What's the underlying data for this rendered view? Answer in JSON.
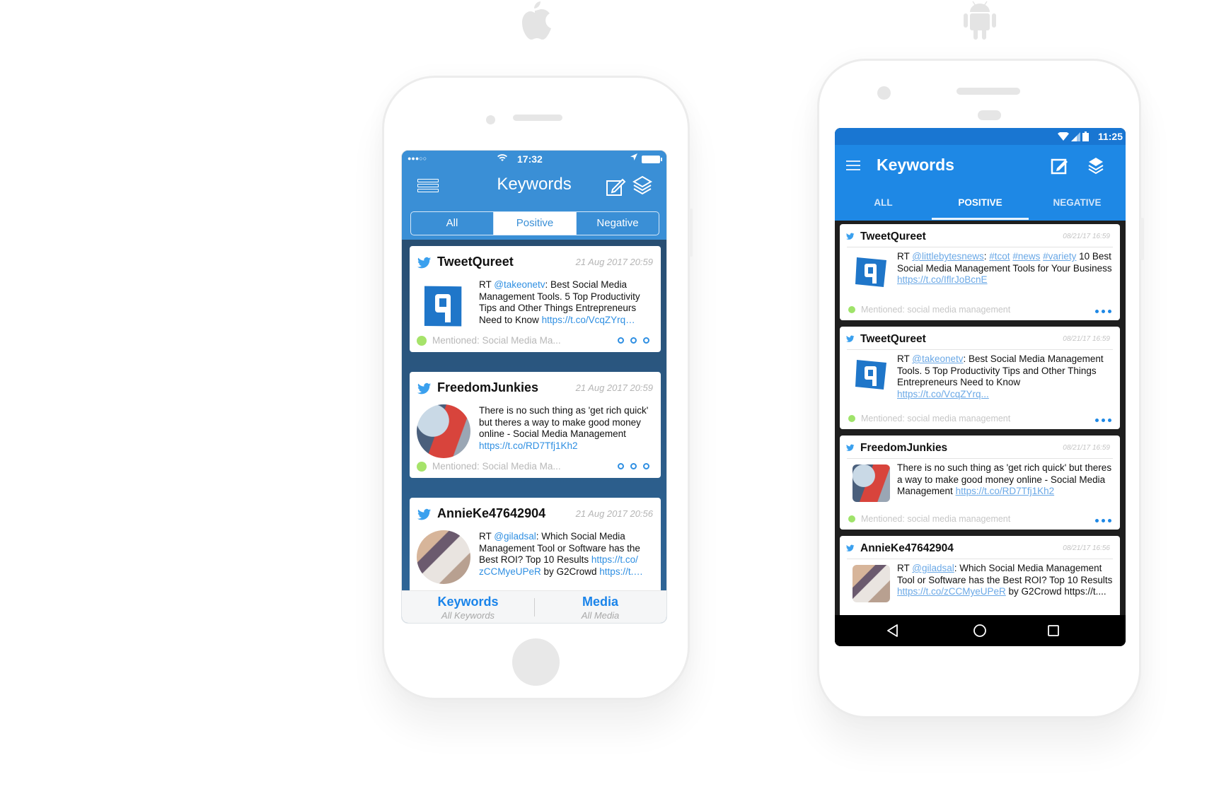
{
  "platform_logos": [
    "apple-logo",
    "android-logo"
  ],
  "ios": {
    "status_bar": {
      "signal": "●●●○○",
      "time": "17:32",
      "wifi_icon": "wifi-icon",
      "location_icon": "location-arrow-icon",
      "battery_icon": "battery-icon"
    },
    "nav": {
      "title": "Keywords",
      "menu_icon": "menu-icon",
      "compose_icon": "compose-icon",
      "layers_icon": "layers-icon"
    },
    "segments": [
      {
        "label": "All",
        "active": false
      },
      {
        "label": "Positive",
        "active": true
      },
      {
        "label": "Negative",
        "active": false
      }
    ],
    "tweets": [
      {
        "author": "TweetQureet",
        "date": "21 Aug 2017 20:59",
        "text_parts": [
          {
            "t": "RT ",
            "link": false
          },
          {
            "t": "@takeonetv",
            "link": true
          },
          {
            "t": ": Best Social Media Management Tools. 5 Top Productivity Tips and Other Things Entrepreneurs Need to Know ",
            "link": false
          },
          {
            "t": "https://t.co/VcqZYrq…",
            "link": true
          }
        ],
        "mention": "Mentioned: Social Media Ma...",
        "avatar": "tweetqureet-logo"
      },
      {
        "author": "FreedomJunkies",
        "date": "21 Aug 2017 20:59",
        "text_parts": [
          {
            "t": "There is no such thing as 'get rich quick' but theres a way to make good money online - Social Media Management ",
            "link": false
          },
          {
            "t": "https://t.co/RD7Tfj1Kh2",
            "link": true
          }
        ],
        "mention": "Mentioned: Social Media Ma...",
        "avatar": "freedomjunkies-photo"
      },
      {
        "author": "AnnieKe47642904",
        "date": "21 Aug 2017 20:56",
        "text_parts": [
          {
            "t": "RT ",
            "link": false
          },
          {
            "t": "@giladsal",
            "link": true
          },
          {
            "t": ": Which Social Media Management Tool or Software has the Best ROI? Top 10 Results ",
            "link": false
          },
          {
            "t": "https://t.co/ zCCMyeUPeR",
            "link": true
          },
          {
            "t": " by G2Crowd ",
            "link": false
          },
          {
            "t": "https://t.…",
            "link": true
          }
        ],
        "mention": "",
        "avatar": "anniek-photo"
      }
    ],
    "tab_bar": [
      {
        "title": "Keywords",
        "subtitle": "All Keywords"
      },
      {
        "title": "Media",
        "subtitle": "All Media"
      }
    ]
  },
  "android": {
    "status_bar": {
      "time": "11:25",
      "wifi_icon": "wifi-icon",
      "signal_icon": "signal-icon",
      "battery_icon": "battery-icon"
    },
    "toolbar": {
      "title": "Keywords",
      "menu_icon": "menu-icon",
      "compose_icon": "compose-icon",
      "layers_icon": "layers-icon"
    },
    "tabs": [
      {
        "label": "ALL",
        "active": false
      },
      {
        "label": "POSITIVE",
        "active": true
      },
      {
        "label": "NEGATIVE",
        "active": false
      }
    ],
    "tweets": [
      {
        "author": "TweetQureet",
        "date": "08/21/17 16:59",
        "text_parts": [
          {
            "t": "RT ",
            "link": false
          },
          {
            "t": "@littlebytesnews",
            "link": true
          },
          {
            "t": ": ",
            "link": false
          },
          {
            "t": "#tcot",
            "link": true
          },
          {
            "t": " ",
            "link": false
          },
          {
            "t": "#news",
            "link": true
          },
          {
            "t": " ",
            "link": false
          },
          {
            "t": "#variety",
            "link": true
          },
          {
            "t": " 10 Best Social Media Management Tools for Your Business ",
            "link": false
          },
          {
            "t": "https://t.co/IflrJoBcnE",
            "link": true
          }
        ],
        "mention": "Mentioned: social media management",
        "avatar": "tweetqureet-logo"
      },
      {
        "author": "TweetQureet",
        "date": "08/21/17 16:59",
        "text_parts": [
          {
            "t": "RT ",
            "link": false
          },
          {
            "t": "@takeonetv",
            "link": true
          },
          {
            "t": ": Best Social Media Management Tools. 5 Top Productivity Tips and Other Things Entrepreneurs Need to Know ",
            "link": false
          },
          {
            "t": "https://t.co/VcqZYrq...",
            "link": true
          }
        ],
        "mention": "Mentioned: social media management",
        "avatar": "tweetqureet-logo"
      },
      {
        "author": "FreedomJunkies",
        "date": "08/21/17 16:59",
        "text_parts": [
          {
            "t": "There is no such thing as 'get rich quick' but theres a way to make good money online - Social Media Management ",
            "link": false
          },
          {
            "t": "https://t.co/RD7Tfj1Kh2",
            "link": true
          }
        ],
        "mention": "Mentioned: social media management",
        "avatar": "freedomjunkies-photo"
      },
      {
        "author": "AnnieKe47642904",
        "date": "08/21/17 16:56",
        "text_parts": [
          {
            "t": "RT ",
            "link": false
          },
          {
            "t": "@giladsal",
            "link": true
          },
          {
            "t": ": Which Social Media Management Tool or Software has the Best ROI? Top 10 Results ",
            "link": false
          },
          {
            "t": "https://t.co/zCCMyeUPeR",
            "link": true
          },
          {
            "t": " by G2Crowd https://t....",
            "link": false
          }
        ],
        "mention": "",
        "avatar": "anniek-photo"
      }
    ],
    "nav_bar": [
      "back-icon",
      "home-icon",
      "recents-icon"
    ]
  },
  "colors": {
    "ios_header": "#3a8fd6",
    "android_primary": "#1e88e5",
    "link": "#2f8fe2",
    "mention_dot": "#a6e36a"
  }
}
